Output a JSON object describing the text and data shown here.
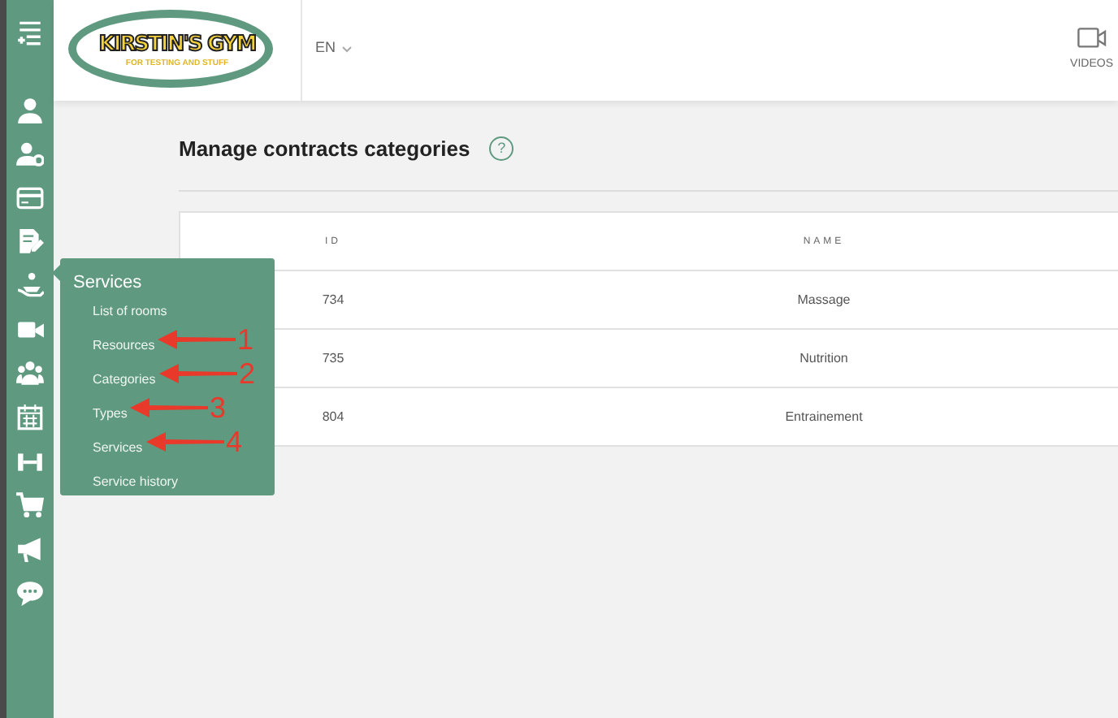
{
  "header": {
    "logo": {
      "title": "KIRSTIN'S GYM",
      "tagline": "FOR TESTING AND STUFF"
    },
    "language": "EN",
    "videos_label": "VIDEOS"
  },
  "page": {
    "title": "Manage contracts categories",
    "help": "?"
  },
  "table": {
    "columns": [
      "ID",
      "NAME"
    ],
    "rows": [
      [
        "734",
        "Massage"
      ],
      [
        "735",
        "Nutrition"
      ],
      [
        "804",
        "Entrainement"
      ]
    ]
  },
  "flyout": {
    "title": "Services",
    "items": [
      {
        "label": "List of rooms"
      },
      {
        "label": "Resources",
        "annotation": "1"
      },
      {
        "label": "Categories",
        "annotation": "2"
      },
      {
        "label": "Types",
        "annotation": "3"
      },
      {
        "label": "Services",
        "annotation": "4"
      },
      {
        "label": "Service history"
      }
    ]
  }
}
